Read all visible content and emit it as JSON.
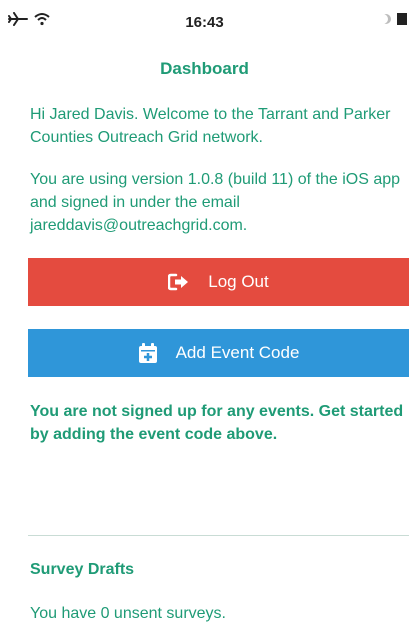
{
  "status_bar": {
    "time": "16:43",
    "icons": [
      "airplane-icon",
      "wifi-icon",
      "moon-icon",
      "battery-icon"
    ]
  },
  "page": {
    "title": "Dashboard"
  },
  "welcome": {
    "line1": "Hi Jared Davis. Welcome to the Tarrant and Parker Counties Outreach Grid network.",
    "line2": "You are using version 1.0.8 (build 11) of the iOS app and signed in under the email jareddavis@outreachgrid.com."
  },
  "actions": {
    "logout_label": "Log Out",
    "add_event_label": "Add Event Code"
  },
  "events": {
    "empty_message": "You are not signed up for any events. Get started by adding the event code above."
  },
  "survey_drafts": {
    "title": "Survey Drafts",
    "status": "You have 0 unsent surveys."
  },
  "colors": {
    "accent_green": "#1f9b76",
    "logout_red": "#e44b3f",
    "event_blue": "#2f96d9"
  }
}
